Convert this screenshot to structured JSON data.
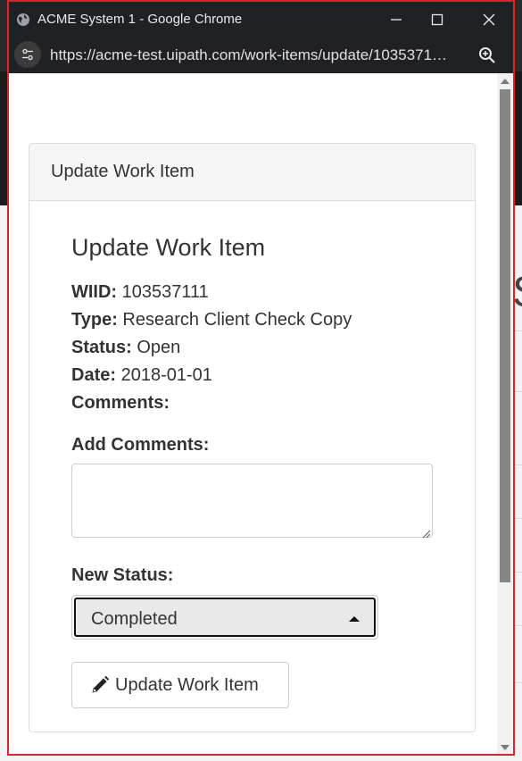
{
  "browser": {
    "window_title": "ACME System 1 - Google Chrome",
    "url": "https://acme-test.uipath.com/work-items/update/1035371…"
  },
  "panel": {
    "heading": "Update Work Item"
  },
  "form": {
    "title": "Update Work Item",
    "wiid_label": "WIID:",
    "wiid_value": "103537111",
    "type_label": "Type:",
    "type_value": "Research Client Check Copy",
    "status_label": "Status:",
    "status_value": "Open",
    "date_label": "Date:",
    "date_value": "2018-01-01",
    "comments_label": "Comments:",
    "add_comments_label": "Add Comments:",
    "add_comments_value": "",
    "new_status_label": "New Status:",
    "new_status_selected": "Completed",
    "submit_label": "Update Work Item"
  },
  "icons": {
    "site": "globe-icon",
    "minimize": "minimize-icon",
    "maximize": "maximize-icon",
    "close": "close-icon",
    "site_settings": "tune-icon",
    "zoom": "zoom-icon",
    "submit": "pencil-icon"
  },
  "colors": {
    "window_border": "#d8262d",
    "chrome_dark": "#202124"
  }
}
